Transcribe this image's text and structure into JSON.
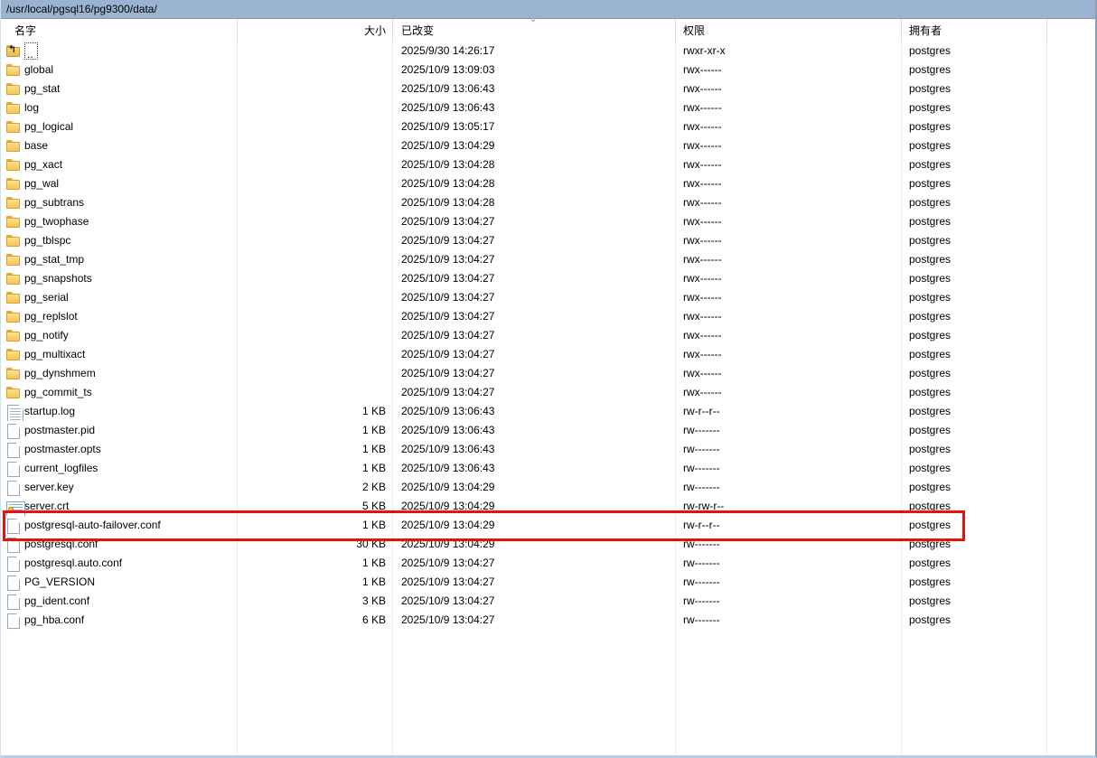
{
  "window": {
    "path": "/usr/local/pgsql16/pg9300/data/"
  },
  "colors": {
    "path_bar_bg": "#99b3d1",
    "highlight_red": "#e8100c"
  },
  "table": {
    "columns": [
      {
        "key": "name",
        "label": "名字"
      },
      {
        "key": "size",
        "label": "大小"
      },
      {
        "key": "changed",
        "label": "已改变",
        "sort": "descending"
      },
      {
        "key": "rights",
        "label": "权限"
      },
      {
        "key": "owner",
        "label": "拥有者"
      }
    ],
    "rows": [
      {
        "icon": "folder-up-icon",
        "name": "..",
        "size": "",
        "changed": "2025/9/30 14:26:17",
        "rights": "rwxr-xr-x",
        "owner": "postgres",
        "focused": true
      },
      {
        "icon": "folder-icon",
        "name": "global",
        "size": "",
        "changed": "2025/10/9 13:09:03",
        "rights": "rwx------",
        "owner": "postgres"
      },
      {
        "icon": "folder-icon",
        "name": "pg_stat",
        "size": "",
        "changed": "2025/10/9 13:06:43",
        "rights": "rwx------",
        "owner": "postgres"
      },
      {
        "icon": "folder-icon",
        "name": "log",
        "size": "",
        "changed": "2025/10/9 13:06:43",
        "rights": "rwx------",
        "owner": "postgres"
      },
      {
        "icon": "folder-icon",
        "name": "pg_logical",
        "size": "",
        "changed": "2025/10/9 13:05:17",
        "rights": "rwx------",
        "owner": "postgres"
      },
      {
        "icon": "folder-icon",
        "name": "base",
        "size": "",
        "changed": "2025/10/9 13:04:29",
        "rights": "rwx------",
        "owner": "postgres"
      },
      {
        "icon": "folder-icon",
        "name": "pg_xact",
        "size": "",
        "changed": "2025/10/9 13:04:28",
        "rights": "rwx------",
        "owner": "postgres"
      },
      {
        "icon": "folder-icon",
        "name": "pg_wal",
        "size": "",
        "changed": "2025/10/9 13:04:28",
        "rights": "rwx------",
        "owner": "postgres"
      },
      {
        "icon": "folder-icon",
        "name": "pg_subtrans",
        "size": "",
        "changed": "2025/10/9 13:04:28",
        "rights": "rwx------",
        "owner": "postgres"
      },
      {
        "icon": "folder-icon",
        "name": "pg_twophase",
        "size": "",
        "changed": "2025/10/9 13:04:27",
        "rights": "rwx------",
        "owner": "postgres"
      },
      {
        "icon": "folder-icon",
        "name": "pg_tblspc",
        "size": "",
        "changed": "2025/10/9 13:04:27",
        "rights": "rwx------",
        "owner": "postgres"
      },
      {
        "icon": "folder-icon",
        "name": "pg_stat_tmp",
        "size": "",
        "changed": "2025/10/9 13:04:27",
        "rights": "rwx------",
        "owner": "postgres"
      },
      {
        "icon": "folder-icon",
        "name": "pg_snapshots",
        "size": "",
        "changed": "2025/10/9 13:04:27",
        "rights": "rwx------",
        "owner": "postgres"
      },
      {
        "icon": "folder-icon",
        "name": "pg_serial",
        "size": "",
        "changed": "2025/10/9 13:04:27",
        "rights": "rwx------",
        "owner": "postgres"
      },
      {
        "icon": "folder-icon",
        "name": "pg_replslot",
        "size": "",
        "changed": "2025/10/9 13:04:27",
        "rights": "rwx------",
        "owner": "postgres"
      },
      {
        "icon": "folder-icon",
        "name": "pg_notify",
        "size": "",
        "changed": "2025/10/9 13:04:27",
        "rights": "rwx------",
        "owner": "postgres"
      },
      {
        "icon": "folder-icon",
        "name": "pg_multixact",
        "size": "",
        "changed": "2025/10/9 13:04:27",
        "rights": "rwx------",
        "owner": "postgres"
      },
      {
        "icon": "folder-icon",
        "name": "pg_dynshmem",
        "size": "",
        "changed": "2025/10/9 13:04:27",
        "rights": "rwx------",
        "owner": "postgres"
      },
      {
        "icon": "folder-icon",
        "name": "pg_commit_ts",
        "size": "",
        "changed": "2025/10/9 13:04:27",
        "rights": "rwx------",
        "owner": "postgres"
      },
      {
        "icon": "file-text-icon",
        "name": "startup.log",
        "size": "1 KB",
        "changed": "2025/10/9 13:06:43",
        "rights": "rw-r--r--",
        "owner": "postgres"
      },
      {
        "icon": "file-icon",
        "name": "postmaster.pid",
        "size": "1 KB",
        "changed": "2025/10/9 13:06:43",
        "rights": "rw-------",
        "owner": "postgres"
      },
      {
        "icon": "file-icon",
        "name": "postmaster.opts",
        "size": "1 KB",
        "changed": "2025/10/9 13:06:43",
        "rights": "rw-------",
        "owner": "postgres"
      },
      {
        "icon": "file-icon",
        "name": "current_logfiles",
        "size": "1 KB",
        "changed": "2025/10/9 13:06:43",
        "rights": "rw-------",
        "owner": "postgres"
      },
      {
        "icon": "file-icon",
        "name": "server.key",
        "size": "2 KB",
        "changed": "2025/10/9 13:04:29",
        "rights": "rw-------",
        "owner": "postgres"
      },
      {
        "icon": "file-cert-icon",
        "name": "server.crt",
        "size": "5 KB",
        "changed": "2025/10/9 13:04:29",
        "rights": "rw-rw-r--",
        "owner": "postgres"
      },
      {
        "icon": "file-icon",
        "name": "postgresql-auto-failover.conf",
        "size": "1 KB",
        "changed": "2025/10/9 13:04:29",
        "rights": "rw-r--r--",
        "owner": "postgres",
        "highlighted": true
      },
      {
        "icon": "file-icon",
        "name": "postgresql.conf",
        "size": "30 KB",
        "changed": "2025/10/9 13:04:29",
        "rights": "rw-------",
        "owner": "postgres"
      },
      {
        "icon": "file-icon",
        "name": "postgresql.auto.conf",
        "size": "1 KB",
        "changed": "2025/10/9 13:04:27",
        "rights": "rw-------",
        "owner": "postgres"
      },
      {
        "icon": "file-icon",
        "name": "PG_VERSION",
        "size": "1 KB",
        "changed": "2025/10/9 13:04:27",
        "rights": "rw-------",
        "owner": "postgres"
      },
      {
        "icon": "file-icon",
        "name": "pg_ident.conf",
        "size": "3 KB",
        "changed": "2025/10/9 13:04:27",
        "rights": "rw-------",
        "owner": "postgres"
      },
      {
        "icon": "file-icon",
        "name": "pg_hba.conf",
        "size": "6 KB",
        "changed": "2025/10/9 13:04:27",
        "rights": "rw-------",
        "owner": "postgres"
      }
    ]
  },
  "highlight": {
    "target_row": "postgresql-auto-failover.conf"
  }
}
